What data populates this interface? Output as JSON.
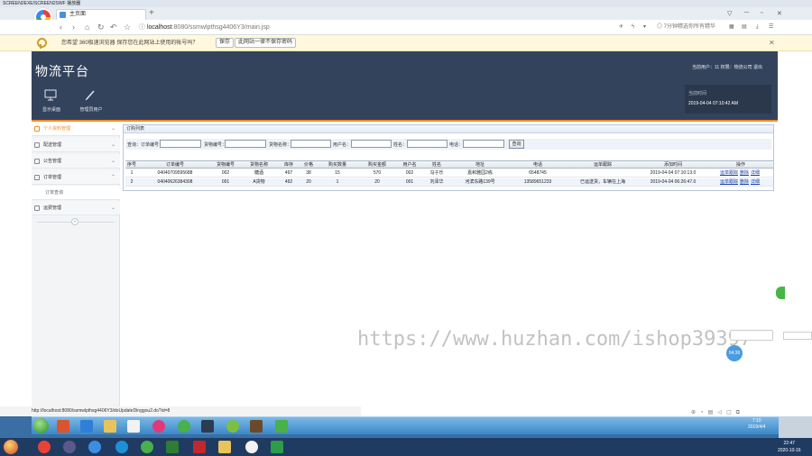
{
  "player": {
    "title": "SCREEN2EXE/SCREEN2SWF 播放器"
  },
  "browser": {
    "tab_title": "主页面",
    "new_tab": "+",
    "url_host": "localhost",
    "url_path": ":8080/ssmwlpthsg4406Y3/main.jsp",
    "address_right": "7分钟精选你所有精华",
    "infobar": {
      "text": "您希望 360极速浏览器 保存您在此网站上使用的帐号吗？",
      "save_label": "保存",
      "never_label": "此网站一律不保存密码"
    },
    "status_url": "http://localhost:8080/ssmwlpthsg4406Y3/doUpdateDinggou2.do?id=8"
  },
  "app": {
    "title": "物流平台",
    "user_info": "当前用户：11 权限：物流公司 退出",
    "header_buttons": [
      {
        "label": "显示桌面",
        "icon": "monitor-icon"
      },
      {
        "label": "管理员用户",
        "icon": "pen-icon"
      }
    ],
    "time_panel": {
      "title": "当前时间",
      "value": "2019-04-04 07:10:42 AM"
    },
    "sidebar": {
      "items": [
        {
          "label": "个人资料管理",
          "icon": "edit-icon",
          "active": true
        },
        {
          "label": "配送管理",
          "icon": "list-icon",
          "active": false
        },
        {
          "label": "公告管理",
          "icon": "list-icon",
          "active": false
        },
        {
          "label": "订单管理",
          "icon": "folder-icon",
          "active": false
        },
        {
          "label": "运费管理",
          "icon": "list-icon",
          "active": false
        }
      ],
      "sub_item": "订单查询"
    },
    "panel_title": "订购列表",
    "search": {
      "prefix": "查询：订单编号：",
      "label_goods_no": "货物编号：",
      "label_goods_name": "货物名称：",
      "label_user": "用户名：",
      "label_name": "姓名：",
      "label_phone": "电话：",
      "button": "查询"
    },
    "table": {
      "columns": [
        "序号",
        "订单编号",
        "货物编号",
        "货物名称",
        "库存",
        "价格",
        "购买数量",
        "购买金额",
        "用户名",
        "姓名",
        "地址",
        "电话",
        "运单跟踪",
        "添加时间",
        "操作"
      ],
      "rows": [
        [
          "1",
          "04040709595688",
          "002",
          "糖酒",
          "497",
          "38",
          "15",
          "570",
          "002",
          "冯子乐",
          "嘉和雅园2栋",
          "6548745",
          "",
          "2019-04-04 07:10:13.0"
        ],
        [
          "2",
          "04040626384308",
          "001",
          "A货物",
          "492",
          "20",
          "1",
          "20",
          "001",
          "刘泽华",
          "河滨东路139号",
          "13589651233",
          "已运送货，车辆在上海",
          "2019-04-04 06:26:47.0"
        ]
      ],
      "actions": [
        "运单跟踪",
        "删除",
        "详细"
      ]
    }
  },
  "watermark": "https://www.huzhan.com/ishop39397",
  "float_badge": "04:36",
  "taskbar_inner": {
    "time": "7:10",
    "date": "2019/4/4"
  },
  "taskbar_outer": {
    "time": "22:47",
    "date": "2020-10-16"
  },
  "colors": {
    "header": "#34435c",
    "accent": "#f08c2a",
    "link": "#1a3ea8"
  }
}
